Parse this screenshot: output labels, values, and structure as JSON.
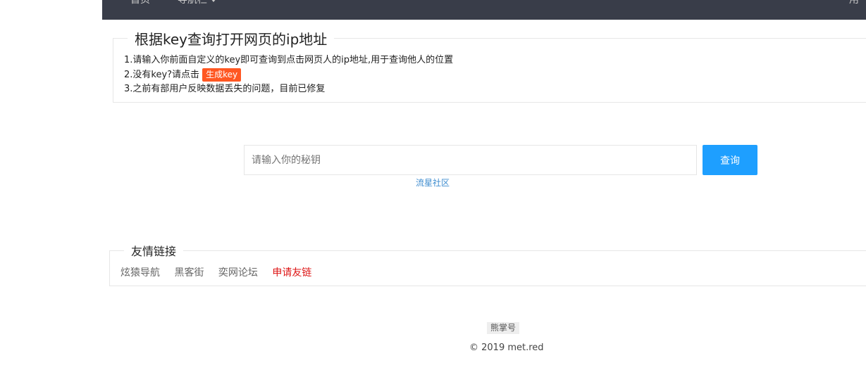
{
  "nav": {
    "home": "首页",
    "guide": "导航栏",
    "right": "用"
  },
  "intro": {
    "title": "根据key查询打开网页的ip地址",
    "tip1": "1.请输入你前面自定义的key即可查询到点击网页人的ip地址,用于查询他人的位置",
    "tip2_prefix": "2.没有key?请点击",
    "generate_key_label": "生成key",
    "tip3": "3.之前有部用户反映数据丢失的问题，目前已修复"
  },
  "search": {
    "placeholder": "请输入你的秘钥",
    "query_label": "查询",
    "community_link": "流星社区"
  },
  "friend_links": {
    "title": "友情链接",
    "items": [
      "炫猿导航",
      "黑客街",
      "奕网论坛"
    ],
    "apply": "申请友链"
  },
  "footer": {
    "badge": "熊掌号",
    "copyright": "© 2019 met.red"
  },
  "colors": {
    "nav_bg": "#393d49",
    "generate_key_btn": "#ff5722",
    "query_btn": "#1e9fff",
    "apply_link": "#dd1515"
  }
}
